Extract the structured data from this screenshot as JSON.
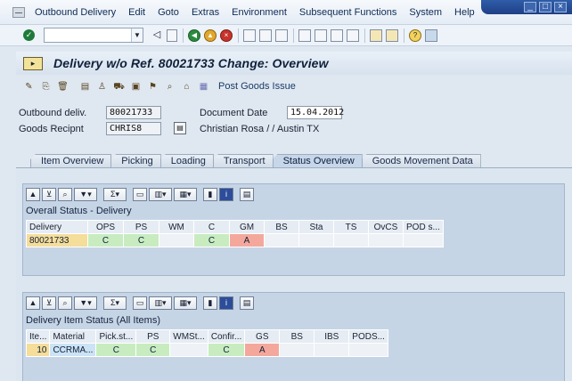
{
  "menu": {
    "items": [
      "Outbound Delivery",
      "Edit",
      "Goto",
      "Extras",
      "Environment",
      "Subsequent Functions",
      "System",
      "Help"
    ]
  },
  "window_controls": {
    "minimize": "_",
    "maximize": "□",
    "close": "×"
  },
  "toolbar": {
    "command_value": "",
    "icons": [
      "check-icon",
      "back-icon",
      "exit-icon",
      "cancel-icon",
      "print-icon",
      "find-icon",
      "find-next-icon",
      "first-page-icon",
      "prev-page-icon",
      "next-page-icon",
      "last-page-icon",
      "new-session-icon",
      "shortcut-icon",
      "help-icon",
      "layout-icon"
    ]
  },
  "title": {
    "text": "Delivery w/o Ref. 80021733 Change: Overview"
  },
  "app_toolbar": {
    "post_goods_issue": "Post Goods Issue"
  },
  "header": {
    "outbound_delivery_label": "Outbound deliv.",
    "outbound_delivery_value": "80021733",
    "goods_recipient_label": "Goods Recipnt",
    "goods_recipient_value": "CHRIS8",
    "document_date_label": "Document Date",
    "document_date_value": "15.04.2012",
    "recipient_address": "Christian Rosa / / Austin TX"
  },
  "tabs": [
    "Item Overview",
    "Picking",
    "Loading",
    "Transport",
    "Status Overview",
    "Goods Movement Data"
  ],
  "active_tab": "Status Overview",
  "overall_status": {
    "title": "Overall Status - Delivery",
    "columns": [
      "Delivery",
      "OPS",
      "PS",
      "WM",
      "C",
      "GM",
      "BS",
      "Sta",
      "TS",
      "OvCS",
      "POD s..."
    ],
    "row": [
      "80021733",
      "C",
      "C",
      "",
      "C",
      "A",
      "",
      "",
      "",
      "",
      ""
    ]
  },
  "item_status": {
    "title": "Delivery Item Status (All Items)",
    "columns": [
      "Ite...",
      "Material",
      "Pick.st...",
      "PS",
      "WMSt...",
      "Confir...",
      "GS",
      "BS",
      "IBS",
      "PODS..."
    ],
    "row": [
      "10",
      "CCRMA...",
      "C",
      "C",
      "",
      "C",
      "A",
      "",
      "",
      ""
    ]
  },
  "colors": {
    "status_green": "#c8ecc0",
    "status_red": "#f4a89c",
    "key_yellow": "#f5dd9a",
    "material_blue": "#cbe3f4"
  }
}
